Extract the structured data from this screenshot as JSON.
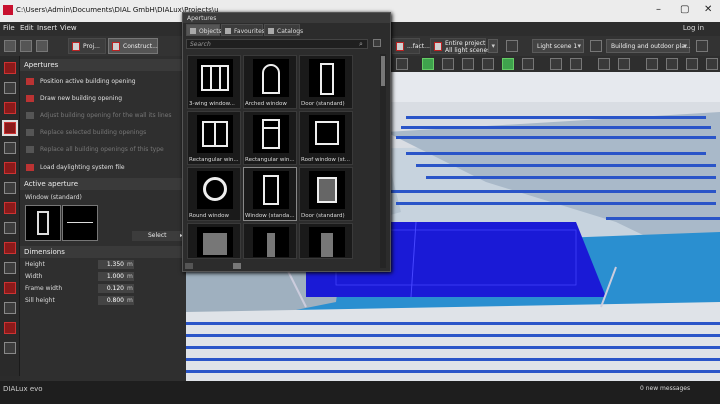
{
  "window": {
    "title": "C:\\Users\\Admin\\Documents\\DIAL GmbH\\DIALux\\Projects\\u"
  },
  "menu": {
    "items": [
      "File",
      "Edit",
      "Insert",
      "View"
    ],
    "login": "Log in"
  },
  "toolbar": {
    "project_label": "Proj...",
    "construct_label": "Construct...",
    "fact_label": "...fact...",
    "entire_project": "Entire project",
    "all_light_scenes": "All light scenes",
    "light_scene": "Light scene 1",
    "building_scope": "Building and outdoor pla..."
  },
  "left_panel": {
    "apertures_title": "Apertures",
    "actions": [
      {
        "label": "Position active building opening",
        "enabled": true
      },
      {
        "label": "Draw new building opening",
        "enabled": true
      },
      {
        "label": "Adjust building opening for the wall its lines",
        "enabled": false
      },
      {
        "label": "Replace selected building openings",
        "enabled": false
      },
      {
        "label": "Replace all building openings of this type",
        "enabled": false
      },
      {
        "label": "Load daylighting system file",
        "enabled": true
      }
    ],
    "active_aperture_title": "Active aperture",
    "active_aperture_name": "Window (standard)",
    "select_label": "Select",
    "dimensions_title": "Dimensions",
    "dimensions": [
      {
        "label": "Height",
        "value": "1.350",
        "unit": "m"
      },
      {
        "label": "Width",
        "value": "1.000",
        "unit": "m"
      },
      {
        "label": "Frame width",
        "value": "0.120",
        "unit": "m"
      },
      {
        "label": "Sill height",
        "value": "0.800",
        "unit": "m"
      }
    ]
  },
  "catalog": {
    "title": "Apertures",
    "tabs": [
      "Objects",
      "Favourites",
      "Catalogs"
    ],
    "search_placeholder": "Search",
    "items": [
      {
        "label": "3-wing window..."
      },
      {
        "label": "Arched window"
      },
      {
        "label": "Door (standard)"
      },
      {
        "label": "Rectangular win..."
      },
      {
        "label": "Rectangular win..."
      },
      {
        "label": "Roof window (st..."
      },
      {
        "label": "Round window"
      },
      {
        "label": "Window (standa..."
      },
      {
        "label": "Door (standard)"
      },
      {
        "label": ""
      },
      {
        "label": ""
      },
      {
        "label": ""
      }
    ]
  },
  "status": {
    "logo": "DIALux evo",
    "messages": "0 new messages"
  },
  "colors": {
    "accent_red": "#b22222",
    "green": "#3fa34d",
    "floor_blue": "#1a1ad6",
    "seat_blue": "#2a55c8"
  }
}
